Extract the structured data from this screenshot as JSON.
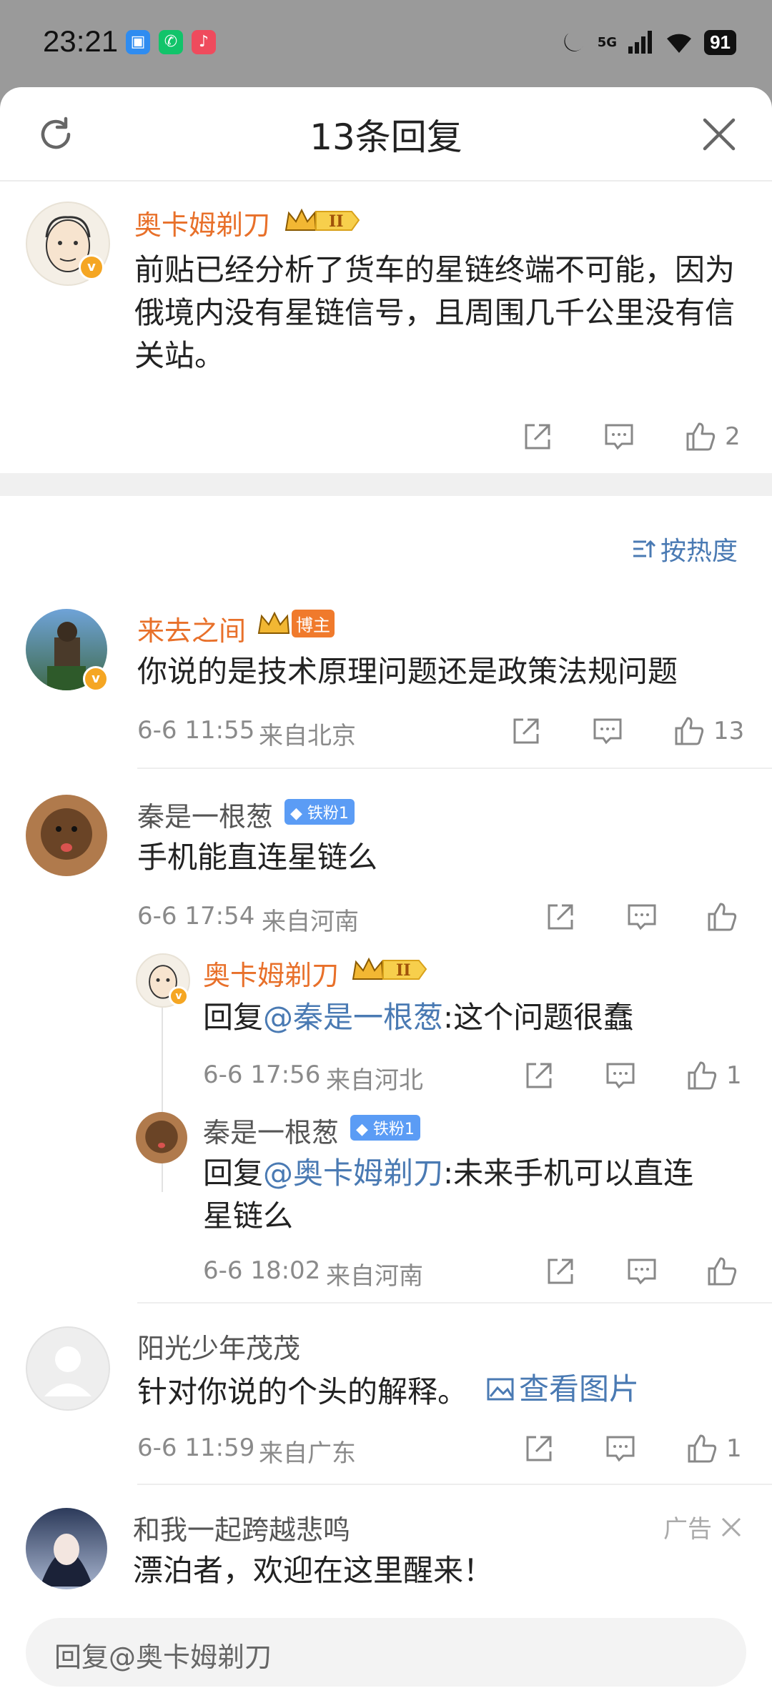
{
  "status": {
    "time": "23:21",
    "network": "5G",
    "battery": "91"
  },
  "header": {
    "title": "13条回复"
  },
  "root_comment": {
    "user": "奥卡姆剃刀",
    "badge": "II",
    "text": "前贴已经分析了货车的星链终端不可能，因为俄境内没有星链信号，且周围几千公里没有信关站。",
    "likes": "2"
  },
  "sort_label": "按热度",
  "comments": [
    {
      "user": "来去之间",
      "tag": "博主",
      "text": "你说的是技术原理问题还是政策法规问题",
      "time": "6-6 11:55",
      "location": "来自北京",
      "likes": "13"
    },
    {
      "user": "秦是一根葱",
      "tag": "铁粉1",
      "text": "手机能直连星链么",
      "time": "6-6 17:54",
      "location": "来自河南",
      "likes": ""
    },
    {
      "user": "奥卡姆剃刀",
      "badge": "II",
      "reply_prefix": "回复",
      "mention": "@秦是一根葱",
      "text": ":这个问题很蠢",
      "time": "6-6 17:56",
      "location": "来自河北",
      "likes": "1"
    },
    {
      "user": "秦是一根葱",
      "tag": "铁粉1",
      "reply_prefix": "回复",
      "mention": "@奥卡姆剃刀",
      "text": ":未来手机可以直连",
      "text2": "星链么",
      "time": "6-6 18:02",
      "location": "来自河南",
      "likes": ""
    },
    {
      "user": "阳光少年茂茂",
      "text": "针对你说的个头的解释。",
      "link": "查看图片",
      "time": "6-6 11:59",
      "location": "来自广东",
      "likes": "1"
    },
    {
      "user": "和我一起跨越悲鸣",
      "ad_label": "广告",
      "text": "漂泊者，欢迎在这里醒来！"
    }
  ],
  "reply_bar": {
    "placeholder": "回复@奥卡姆剃刀"
  },
  "colors": {
    "accent": "#e8702a",
    "link": "#4a7ab3"
  }
}
